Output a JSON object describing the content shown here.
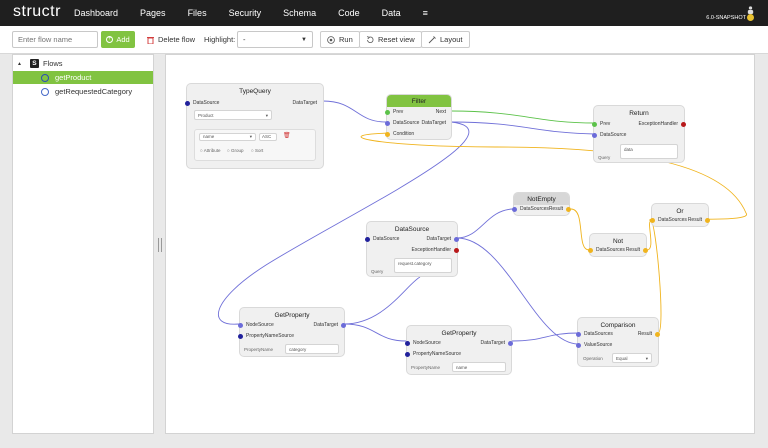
{
  "app": {
    "logo": "structr",
    "version": "6.0-SNAPSHOT"
  },
  "nav": {
    "items": [
      "Dashboard",
      "Pages",
      "Files",
      "Security",
      "Schema",
      "Code",
      "Data",
      "≡"
    ]
  },
  "toolbar": {
    "flow_name_placeholder": "Enter flow name",
    "add_label": "Add",
    "delete_label": "Delete flow",
    "highlight_label": "Highlight:",
    "highlight_value": "-",
    "run_label": "Run",
    "reset_label": "Reset view",
    "layout_label": "Layout"
  },
  "sidebar": {
    "root_label": "Flows",
    "root_badge": "S",
    "items": [
      {
        "label": "getProduct",
        "selected": true
      },
      {
        "label": "getRequestedCategory",
        "selected": false
      }
    ]
  },
  "nodes": {
    "typequery": {
      "title": "TypeQuery",
      "in_port": "DataSource",
      "out_port": "DataTarget",
      "type_value": "Product",
      "sort_field": "name",
      "sort_order": "ASC",
      "opt_attribute": "Attribute",
      "opt_group": "Group",
      "opt_sort": "Sort"
    },
    "filter": {
      "title": "Filter",
      "prev": "Prev",
      "next": "Next",
      "datasource": "DataSource",
      "datatarget": "DataTarget",
      "condition": "Condition"
    },
    "return": {
      "title": "Return",
      "prev": "Prev",
      "exception": "ExceptionHandler",
      "datasource": "DataSource",
      "query_label": "Query",
      "query_value": "data"
    },
    "notempty": {
      "title": "NotEmpty",
      "datasources": "DataSources",
      "result": "Result"
    },
    "or": {
      "title": "Or",
      "datasources": "DataSources",
      "result": "Result"
    },
    "not": {
      "title": "Not",
      "datasources": "DataSources",
      "result": "Result"
    },
    "datasource": {
      "title": "DataSource",
      "datasource": "DataSource",
      "datatarget": "DataTarget",
      "exception": "ExceptionHandler",
      "query_label": "Query",
      "query_value": "request.category"
    },
    "getproperty1": {
      "title": "GetProperty",
      "nodesource": "NodeSource",
      "datatarget": "DataTarget",
      "propnamesource": "PropertyNameSource",
      "propname_label": "PropertyName",
      "propname_value": "category"
    },
    "getproperty2": {
      "title": "GetProperty",
      "nodesource": "NodeSource",
      "datatarget": "DataTarget",
      "propnamesource": "PropertyNameSource",
      "propname_label": "PropertyName",
      "propname_value": "name"
    },
    "comparison": {
      "title": "Comparison",
      "datasources": "DataSources",
      "result": "Result",
      "valuesource": "ValueSource",
      "operation_label": "Operation",
      "operation_value": "Equal"
    }
  },
  "colors": {
    "accent": "#81c341",
    "nav_bg": "#1f1f1f",
    "data_edge": "#7070d8",
    "logic_edge": "#f0b41e",
    "flow_edge": "#5cc24a"
  }
}
